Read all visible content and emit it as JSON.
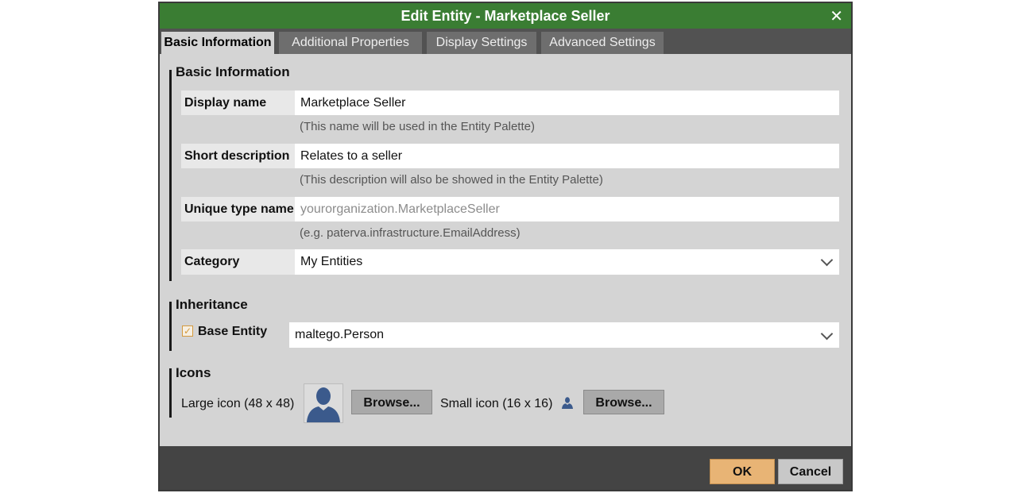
{
  "dialog": {
    "title": "Edit Entity - Marketplace Seller",
    "close_glyph": "✕"
  },
  "tabs": [
    {
      "label": "Basic Information",
      "active": true
    },
    {
      "label": "Additional Properties",
      "active": false
    },
    {
      "label": "Display Settings",
      "active": false
    },
    {
      "label": "Advanced Settings",
      "active": false
    }
  ],
  "basic": {
    "heading": "Basic Information",
    "display_name": {
      "label": "Display name",
      "value": "Marketplace Seller",
      "hint": "(This name will be used in the Entity Palette)"
    },
    "short_description": {
      "label": "Short description",
      "value": "Relates to a seller",
      "hint": "(This description will also be showed in the Entity Palette)"
    },
    "unique_type_name": {
      "label": "Unique type name",
      "placeholder": "yourorganization.MarketplaceSeller",
      "hint": "(e.g. paterva.infrastructure.EmailAddress)"
    },
    "category": {
      "label": "Category",
      "value": "My Entities"
    }
  },
  "inheritance": {
    "heading": "Inheritance",
    "base_entity_label": "Base Entity",
    "base_entity_checked": true,
    "base_entity_value": "maltego.Person"
  },
  "icons": {
    "heading": "Icons",
    "large_label": "Large icon (48 x 48)",
    "small_label": "Small icon (16 x 16)",
    "browse_label": "Browse...",
    "icon_name": "person-silhouette-icon"
  },
  "footer": {
    "ok_label": "OK",
    "cancel_label": "Cancel"
  },
  "colors": {
    "titlebar": "#3a7d33",
    "ok_button": "#e8b475",
    "icon_blue": "#3b5a8c"
  }
}
